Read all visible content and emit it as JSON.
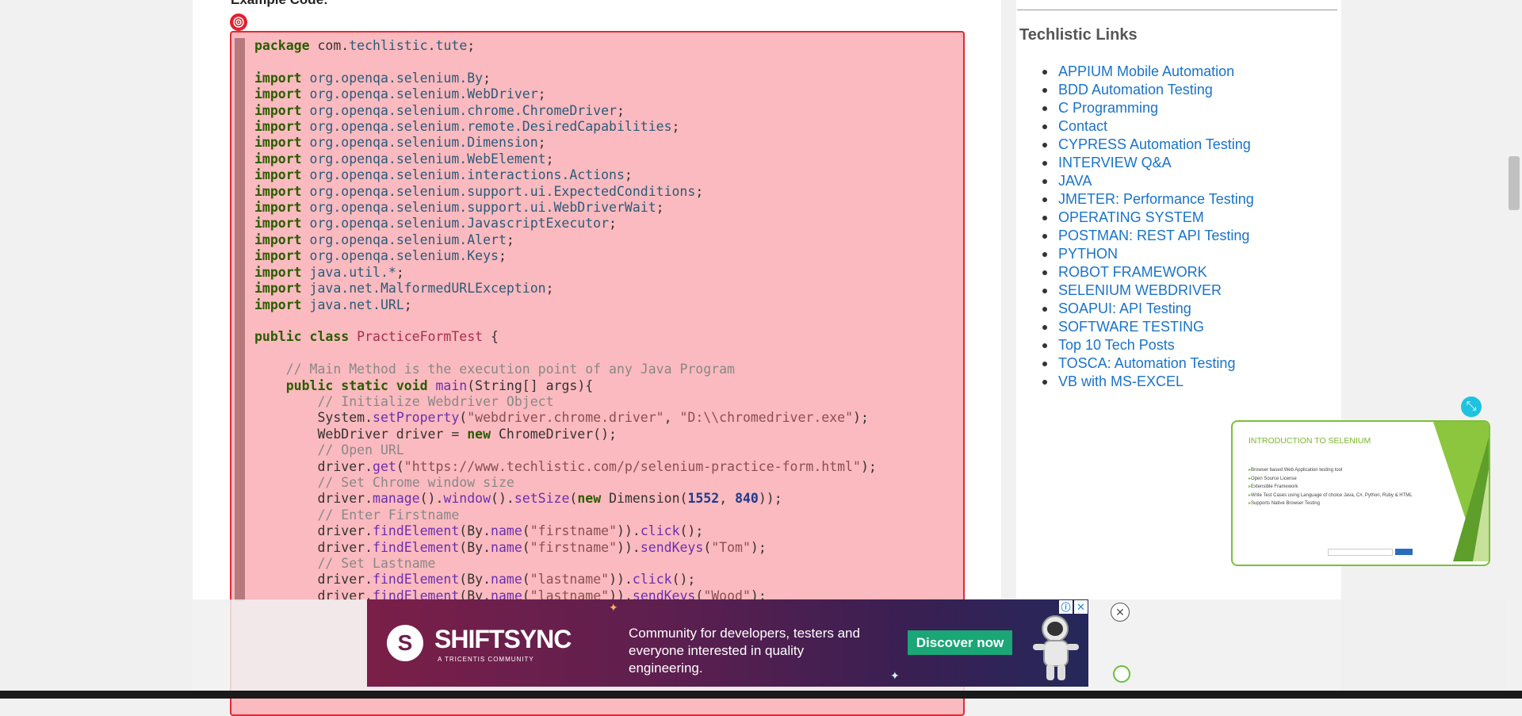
{
  "article": {
    "example_heading": "Example Code:"
  },
  "code": {
    "lines": [
      [
        [
          "kw",
          "package"
        ],
        [
          "",
          "com."
        ],
        [
          "pkg",
          "techlistic"
        ],
        [
          "",
          "."
        ],
        [
          "pkg",
          "tute"
        ],
        [
          "",
          ";"
        ]
      ],
      [],
      [
        [
          "kw",
          "import"
        ],
        [
          "pkg",
          "org.openqa.selenium.By"
        ],
        [
          "",
          ";"
        ]
      ],
      [
        [
          "kw",
          "import"
        ],
        [
          "pkg",
          "org.openqa.selenium.WebDriver"
        ],
        [
          "",
          ";"
        ]
      ],
      [
        [
          "kw",
          "import"
        ],
        [
          "pkg",
          "org.openqa.selenium.chrome.ChromeDriver"
        ],
        [
          "",
          ";"
        ]
      ],
      [
        [
          "kw",
          "import"
        ],
        [
          "pkg",
          "org.openqa.selenium.remote.DesiredCapabilities"
        ],
        [
          "",
          ";"
        ]
      ],
      [
        [
          "kw",
          "import"
        ],
        [
          "pkg",
          "org.openqa.selenium.Dimension"
        ],
        [
          "",
          ";"
        ]
      ],
      [
        [
          "kw",
          "import"
        ],
        [
          "pkg",
          "org.openqa.selenium.WebElement"
        ],
        [
          "",
          ";"
        ]
      ],
      [
        [
          "kw",
          "import"
        ],
        [
          "pkg",
          "org.openqa.selenium.interactions.Actions"
        ],
        [
          "",
          ";"
        ]
      ],
      [
        [
          "kw",
          "import"
        ],
        [
          "pkg",
          "org.openqa.selenium.support.ui.ExpectedConditions"
        ],
        [
          "",
          ";"
        ]
      ],
      [
        [
          "kw",
          "import"
        ],
        [
          "pkg",
          "org.openqa.selenium.support.ui.WebDriverWait"
        ],
        [
          "",
          ";"
        ]
      ],
      [
        [
          "kw",
          "import"
        ],
        [
          "pkg",
          "org.openqa.selenium.JavascriptExecutor"
        ],
        [
          "",
          ";"
        ]
      ],
      [
        [
          "kw",
          "import"
        ],
        [
          "pkg",
          "org.openqa.selenium.Alert"
        ],
        [
          "",
          ";"
        ]
      ],
      [
        [
          "kw",
          "import"
        ],
        [
          "pkg",
          "org.openqa.selenium.Keys"
        ],
        [
          "",
          ";"
        ]
      ],
      [
        [
          "kw",
          "import"
        ],
        [
          "pkg",
          "java.util.*"
        ],
        [
          "",
          ";"
        ]
      ],
      [
        [
          "kw",
          "import"
        ],
        [
          "pkg",
          "java.net.MalformedURLException"
        ],
        [
          "",
          ";"
        ]
      ],
      [
        [
          "kw",
          "import"
        ],
        [
          "pkg",
          "java.net.URL"
        ],
        [
          "",
          ";"
        ]
      ],
      [],
      [
        [
          "kw",
          "public class "
        ],
        [
          "cls",
          "PracticeFormTest"
        ],
        [
          "",
          " {"
        ]
      ],
      [],
      [
        [
          "",
          "    "
        ],
        [
          "cmt",
          "// Main Method is the execution point of any Java Program"
        ]
      ],
      [
        [
          "",
          "    "
        ],
        [
          "kw",
          "public static void "
        ],
        [
          "meth",
          "main"
        ],
        [
          "",
          "(String[] args){"
        ]
      ],
      [
        [
          "",
          "        "
        ],
        [
          "cmt",
          "// Initialize Webdriver Object"
        ]
      ],
      [
        [
          "",
          "        System."
        ],
        [
          "meth",
          "setProperty"
        ],
        [
          "",
          "("
        ],
        [
          "str",
          "\"webdriver.chrome.driver\""
        ],
        [
          "",
          ", "
        ],
        [
          "str",
          "\"D:\\\\chromedriver.exe\""
        ],
        [
          "",
          ");"
        ]
      ],
      [
        [
          "",
          "        WebDriver driver = "
        ],
        [
          "kw",
          "new "
        ],
        [
          "",
          "ChromeDriver();"
        ]
      ],
      [
        [
          "",
          "        "
        ],
        [
          "cmt",
          "// Open URL"
        ]
      ],
      [
        [
          "",
          "        driver."
        ],
        [
          "meth",
          "get"
        ],
        [
          "",
          "("
        ],
        [
          "str",
          "\"https://www.techlistic.com/p/selenium-practice-form.html\""
        ],
        [
          "",
          ");"
        ]
      ],
      [
        [
          "",
          "        "
        ],
        [
          "cmt",
          "// Set Chrome window size"
        ]
      ],
      [
        [
          "",
          "        driver."
        ],
        [
          "meth",
          "manage"
        ],
        [
          "",
          "()."
        ],
        [
          "meth",
          "window"
        ],
        [
          "",
          "()."
        ],
        [
          "meth",
          "setSize"
        ],
        [
          "",
          "("
        ],
        [
          "kw",
          "new "
        ],
        [
          "",
          "Dimension("
        ],
        [
          "num",
          "1552"
        ],
        [
          "",
          ", "
        ],
        [
          "num",
          "840"
        ],
        [
          "",
          "));"
        ]
      ],
      [
        [
          "",
          "        "
        ],
        [
          "cmt",
          "// Enter Firstname"
        ]
      ],
      [
        [
          "",
          "        driver."
        ],
        [
          "meth",
          "findElement"
        ],
        [
          "",
          "(By."
        ],
        [
          "meth",
          "name"
        ],
        [
          "",
          "("
        ],
        [
          "str",
          "\"firstname\""
        ],
        [
          "",
          "))."
        ],
        [
          "meth",
          "click"
        ],
        [
          "",
          "();"
        ]
      ],
      [
        [
          "",
          "        driver."
        ],
        [
          "meth",
          "findElement"
        ],
        [
          "",
          "(By."
        ],
        [
          "meth",
          "name"
        ],
        [
          "",
          "("
        ],
        [
          "str",
          "\"firstname\""
        ],
        [
          "",
          "))."
        ],
        [
          "meth",
          "sendKeys"
        ],
        [
          "",
          "("
        ],
        [
          "str",
          "\"Tom\""
        ],
        [
          "",
          ");"
        ]
      ],
      [
        [
          "",
          "        "
        ],
        [
          "cmt",
          "// Set Lastname"
        ]
      ],
      [
        [
          "",
          "        driver."
        ],
        [
          "meth",
          "findElement"
        ],
        [
          "",
          "(By."
        ],
        [
          "meth",
          "name"
        ],
        [
          "",
          "("
        ],
        [
          "str",
          "\"lastname\""
        ],
        [
          "",
          "))."
        ],
        [
          "meth",
          "click"
        ],
        [
          "",
          "();"
        ]
      ],
      [
        [
          "",
          "        driver."
        ],
        [
          "meth",
          "findElement"
        ],
        [
          "",
          "(By."
        ],
        [
          "meth",
          "name"
        ],
        [
          "",
          "("
        ],
        [
          "str",
          "\"lastname\""
        ],
        [
          "",
          "))."
        ],
        [
          "meth",
          "sendKeys"
        ],
        [
          "",
          "("
        ],
        [
          "str",
          "\"Wood\""
        ],
        [
          "",
          ");"
        ]
      ]
    ]
  },
  "sidebar": {
    "title": "Techlistic Links",
    "links": [
      "APPIUM Mobile Automation",
      "BDD Automation Testing",
      "C Programming",
      "Contact",
      "CYPRESS Automation Testing",
      "INTERVIEW Q&A",
      "JAVA",
      "JMETER: Performance Testing",
      "OPERATING SYSTEM",
      "POSTMAN: REST API Testing",
      "PYTHON",
      "ROBOT FRAMEWORK",
      "SELENIUM WEBDRIVER",
      "SOAPUI: API Testing",
      "SOFTWARE TESTING",
      "Top 10 Tech Posts",
      "TOSCA: Automation Testing",
      "VB with MS-EXCEL"
    ]
  },
  "video": {
    "slide_title": "INTRODUCTION TO SELENIUM",
    "bullets": [
      "Browser based Web Application testing tool",
      "Open Source License",
      "Extensible Framework",
      "Write Test Cases using Language of choice Java, C#, Python, Ruby & HTML",
      "Supports Native Browser Testing"
    ],
    "close_icon": "collapse-arrows-icon"
  },
  "ad": {
    "brand": "SHIFTSYNC",
    "tagline": "A TRICENTIS COMMUNITY",
    "text": "Community for developers, testers and everyone interested in quality engineering.",
    "cta": "Discover now",
    "info_icon": "ⓘ",
    "x_icon": "✕",
    "close_icon": "✕",
    "colors": {
      "bg_start": "#7a1f48",
      "bg_end": "#25285a",
      "cta": "#1aa676"
    }
  },
  "colors": {
    "code_bg": "#fbbabf",
    "code_border": "#e52935",
    "link": "#1a73c8",
    "keyword": "#2a5d00",
    "class_name": "#a82c4d"
  }
}
